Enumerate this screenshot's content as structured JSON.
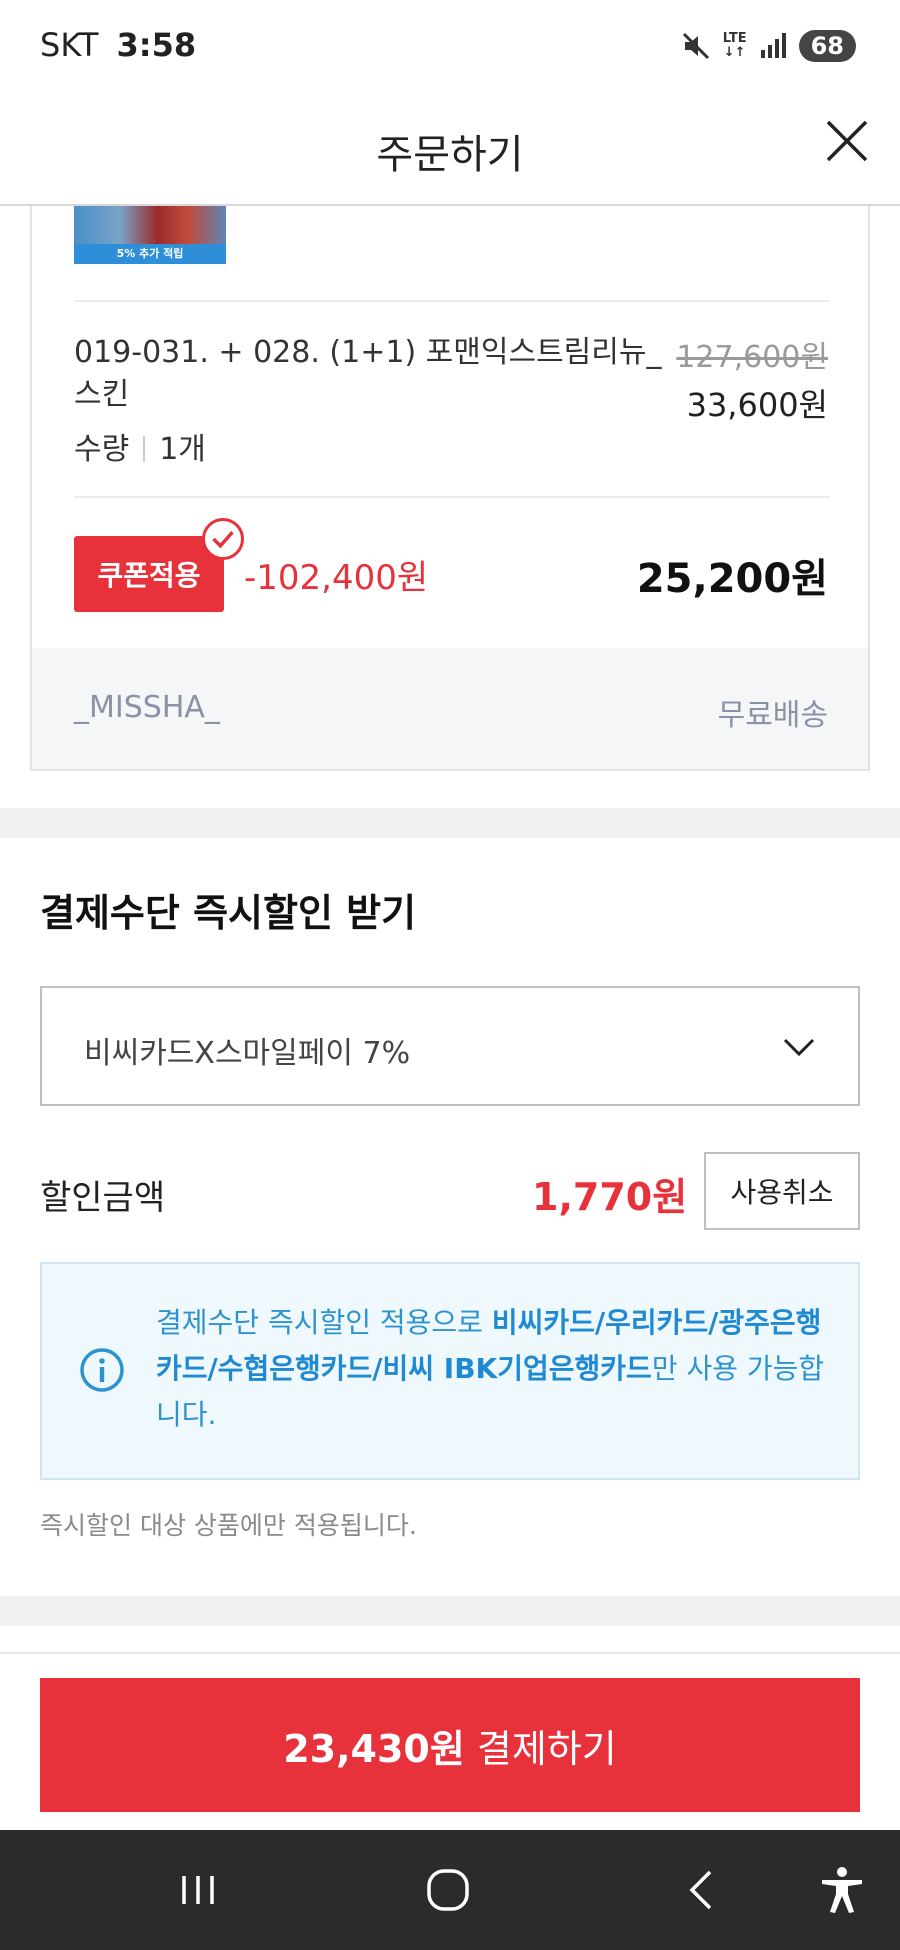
{
  "status_bar": {
    "carrier": "SKT",
    "time": "3:58",
    "network": "LTE",
    "battery": "68"
  },
  "header": {
    "title": "주문하기"
  },
  "order": {
    "thumbnail_caption": "5% 추가 적립",
    "item_name": "019-031. + 028. (1+1) 포맨익스트림리뉴_스킨",
    "quantity_label": "수량",
    "quantity_value": "1개",
    "original_price": "127,600원",
    "sale_price": "33,600원",
    "coupon_label": "쿠폰적용",
    "coupon_discount": "-102,400원",
    "total_price": "25,200원",
    "seller": "_MISSHA_",
    "shipping": "무료배송"
  },
  "instant_discount": {
    "title": "결제수단 즉시할인 받기",
    "selected_option": "비씨카드X스마일페이 7%",
    "discount_label": "할인금액",
    "discount_amount": "1,770원",
    "cancel_label": "사용취소",
    "info_prefix": "결제수단 즉시할인 적용으로 ",
    "info_cards": "비씨카드/우리카드/광주은행카드/수협은행카드/비씨 IBK기업은행카드",
    "info_suffix": "만 사용 가능합니다.",
    "note": "즉시할인 대상 상품에만 적용됩니다."
  },
  "pay_button": {
    "amount": "23,430원",
    "label": " 결제하기"
  },
  "icons": {
    "mute": "mute-icon",
    "signal": "signal-icon",
    "close": "close-icon",
    "check": "check-circle-icon",
    "chevron": "chevron-down-icon",
    "info": "info-icon",
    "recents": "recents-icon",
    "home": "home-icon",
    "back": "back-icon",
    "accessibility": "accessibility-icon"
  },
  "colors": {
    "accent_red": "#e8323b",
    "info_blue": "#2d93cf",
    "info_bg": "#eef8fd"
  }
}
